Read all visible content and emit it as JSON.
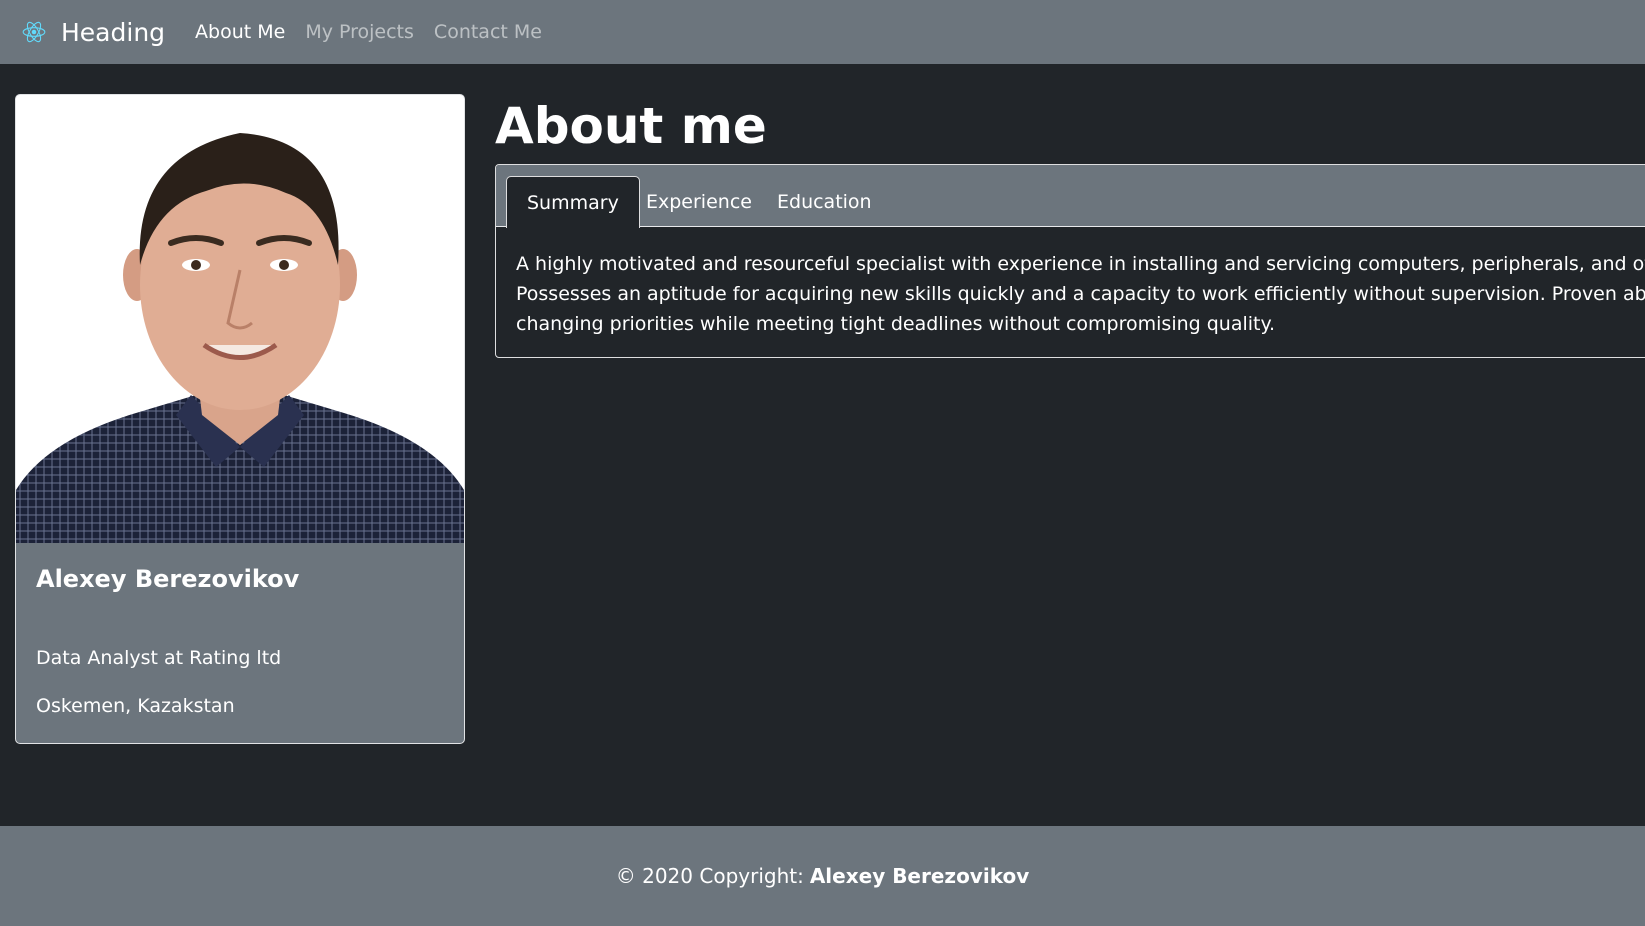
{
  "navbar": {
    "brand": "Heading",
    "brand_icon": "react-atom-icon",
    "links": [
      {
        "label": "About Me",
        "active": true
      },
      {
        "label": "My Projects",
        "active": false
      },
      {
        "label": "Contact Me",
        "active": false
      }
    ]
  },
  "profile": {
    "photo_icon": "profile-photo",
    "name": "Alexey Berezovikov",
    "job": "Data Analyst at Rating ltd",
    "location": "Oskemen, Kazakstan"
  },
  "about": {
    "title": "About me",
    "tabs": [
      "Summary",
      "Experience",
      "Education"
    ],
    "summary": "A highly motivated and resourceful specialist with experience in installing and servicing computers, peripherals, and other electronic devices. Possesses an aptitude for acquiring new skills quickly and a capacity to work efficiently without supervision. Proven ability to adapt to changing priorities while meeting tight deadlines without compromising quality."
  },
  "footer": {
    "prefix": "© 2020 Copyright:",
    "name": "Alexey Berezovikov"
  },
  "colors": {
    "background": "#212529",
    "secondary": "#6c757d",
    "accent": "#61dafb"
  }
}
